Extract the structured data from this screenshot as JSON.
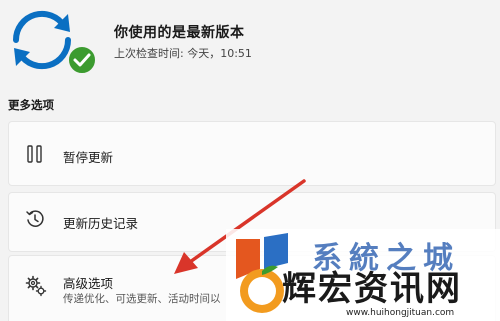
{
  "status": {
    "title": "你使用的是最新版本",
    "subtitle": "上次检查时间: 今天，10:51",
    "icon": "sync-check-icon"
  },
  "section": {
    "title": "更多选项"
  },
  "options": [
    {
      "label": "暂停更新",
      "icon": "pause-icon"
    },
    {
      "label": "更新历史记录",
      "icon": "history-icon"
    },
    {
      "label": "高级选项",
      "description": "传递优化、可选更新、活动时间以",
      "icon": "gears-icon"
    }
  ],
  "annotation": {
    "arrow_color": "#d9352a"
  },
  "watermark": {
    "line1": "系統之城",
    "line2": "辉宏资讯网",
    "url": "www.huihongjituan.com"
  },
  "colors": {
    "sync_blue": "#0a6fc2",
    "check_green": "#3c9b2f",
    "background": "#f3f3f3"
  }
}
